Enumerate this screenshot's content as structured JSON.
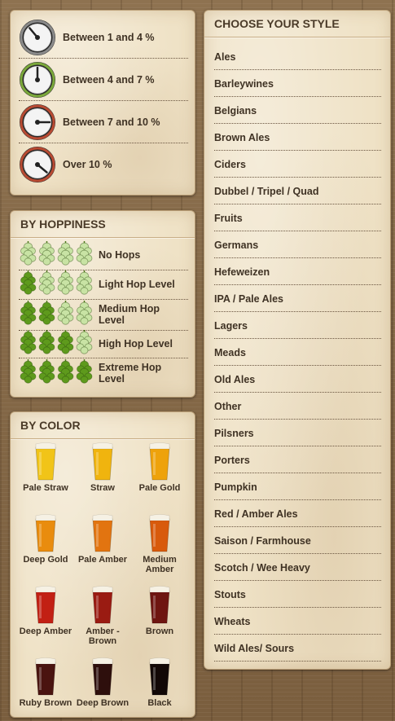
{
  "abv": {
    "items": [
      {
        "label": "Between 1 and 4 %",
        "ring": "#8a8a8a",
        "needle_angle": -40
      },
      {
        "label": "Between 4 and 7 %",
        "ring": "#7aa83a",
        "needle_angle": 0
      },
      {
        "label": "Between 7 and 10 %",
        "ring": "#b84a32",
        "needle_angle": 90
      },
      {
        "label": "Over 10 %",
        "ring": "#b84a32",
        "needle_angle": 130
      }
    ]
  },
  "hops": {
    "title": "BY HOPPINESS",
    "items": [
      {
        "label": "No Hops",
        "level": 0
      },
      {
        "label": "Light Hop Level",
        "level": 1
      },
      {
        "label": "Medium Hop Level",
        "level": 2
      },
      {
        "label": "High Hop Level",
        "level": 3
      },
      {
        "label": "Extreme Hop Level",
        "level": 4
      }
    ],
    "active_color": "#5e9a1c",
    "inactive_color": "#c8e3a4"
  },
  "colors": {
    "title": "BY COLOR",
    "items": [
      {
        "label": "Pale Straw",
        "color": "#f1c418"
      },
      {
        "label": "Straw",
        "color": "#f0b40e"
      },
      {
        "label": "Pale Gold",
        "color": "#eea20b"
      },
      {
        "label": "Deep Gold",
        "color": "#e98c0e"
      },
      {
        "label": "Pale Amber",
        "color": "#e27410"
      },
      {
        "label": "Medium Amber",
        "color": "#d85a0c"
      },
      {
        "label": "Deep Amber",
        "color": "#c22014"
      },
      {
        "label": "Amber - Brown",
        "color": "#9a1b12"
      },
      {
        "label": "Brown",
        "color": "#6e1510"
      },
      {
        "label": "Ruby Brown",
        "color": "#4a1410"
      },
      {
        "label": "Deep Brown",
        "color": "#2e0f0c"
      },
      {
        "label": "Black",
        "color": "#120806"
      }
    ]
  },
  "styles": {
    "title": "CHOOSE YOUR STYLE",
    "items": [
      "Ales",
      "Barleywines",
      "Belgians",
      "Brown Ales",
      "Ciders",
      "Dubbel / Tripel / Quad",
      "Fruits",
      "Germans",
      "Hefeweizen",
      "IPA / Pale Ales",
      "Lagers",
      "Meads",
      "Old Ales",
      "Other",
      "Pilsners",
      "Porters",
      "Pumpkin",
      "Red / Amber Ales",
      "Saison / Farmhouse",
      "Scotch / Wee Heavy",
      "Stouts",
      "Wheats",
      "Wild Ales/ Sours"
    ]
  }
}
